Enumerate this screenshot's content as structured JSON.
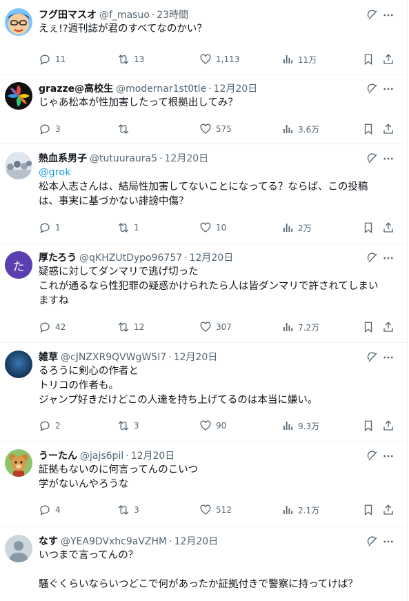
{
  "posts": [
    {
      "name": "フグ田マスオ",
      "handle": "@f_masuo",
      "time": "23時間",
      "avatar": "cartoon-avatar",
      "lines": [
        "えぇ!?週刊誌が君のすべてなのかい？"
      ],
      "replies": "11",
      "retweets": "13",
      "likes": "1,113",
      "views": "11万"
    },
    {
      "name": "grazze@高校生",
      "handle": "@modernar1st0tle",
      "time": "12月20日",
      "avatar": "colorful-leaf-avatar",
      "lines": [
        "じゃあ松本が性加害したって根拠出してみ？"
      ],
      "replies": "3",
      "retweets": "",
      "likes": "575",
      "views": "3.6万"
    },
    {
      "name": "熱血系男子",
      "handle": "@tutuuraura5",
      "time": "12月20日",
      "avatar": "crowd-avatar",
      "mention": "@grok",
      "lines": [
        "松本人志さんは、結局性加害してないことになってる？ならば、この投稿",
        "は、事実に基づかない誹謗中傷？"
      ],
      "replies": "1",
      "retweets": "1",
      "likes": "10",
      "views": "2万"
    },
    {
      "name": "厚たろう",
      "handle": "@qKHZUtDypo96757",
      "time": "12月20日",
      "avatar": "letter-avatar",
      "avatar_letter": "た",
      "lines": [
        "疑惑に対してダンマリで逃げ切った",
        "これが通るなら性犯罪の疑惑かけられたら人は皆ダンマリで許されてしまい",
        "ますね"
      ],
      "replies": "42",
      "retweets": "12",
      "likes": "307",
      "views": "7.2万"
    },
    {
      "name": "雑草",
      "handle": "@cJNZXR9QVWgW5I7",
      "time": "12月20日",
      "avatar": "dark-blue-avatar",
      "lines": [
        "るろうに剣心の作者と",
        "トリコの作者も。",
        "ジャンプ好きだけどこの人達を持ち上げてるのは本当に嫌い。"
      ],
      "replies": "2",
      "retweets": "3",
      "likes": "90",
      "views": "9.3万"
    },
    {
      "name": "うーたん",
      "handle": "@jajs6pil",
      "time": "12月20日",
      "avatar": "bear-avatar",
      "lines": [
        "証拠もないのに何言ってんのこいつ",
        "学がないんやろうな"
      ],
      "replies": "4",
      "retweets": "3",
      "likes": "512",
      "views": "2.1万"
    },
    {
      "name": "なす",
      "handle": "@YEA9DVxhc9aVZHM",
      "time": "12月20日",
      "avatar": "default-avatar",
      "lines": [
        "いつまで言ってんの？",
        "",
        "騒ぐくらいならいつどこで何があったか証拠付きで警察に持ってけば？"
      ]
    }
  ],
  "colors": {
    "text": "#0f1419",
    "secondary": "#536471",
    "link": "#1d9bf0",
    "border": "#eff3f4"
  },
  "icons": {
    "reply": "reply-icon",
    "retweet": "retweet-icon",
    "like": "like-icon",
    "views": "views-icon",
    "bookmark": "bookmark-icon",
    "share": "share-icon",
    "grok": "grok-icon",
    "more": "more-icon"
  }
}
